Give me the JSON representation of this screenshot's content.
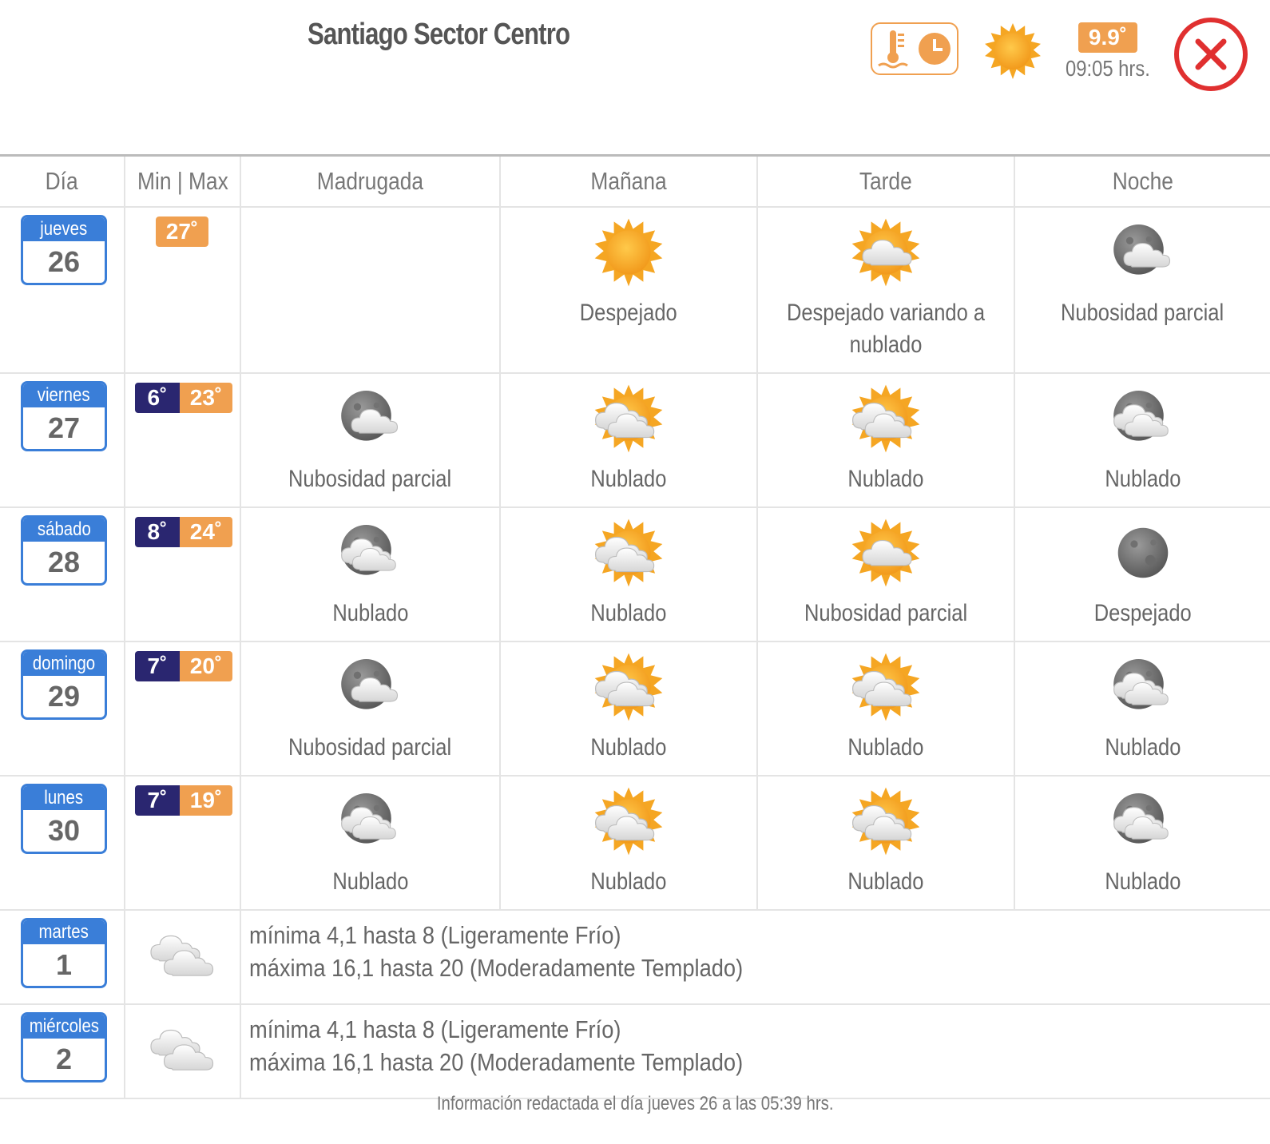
{
  "header": {
    "title": "Santiago Sector Centro",
    "current_temp": "9.9˚",
    "current_time": "09:05 hrs."
  },
  "columns": [
    "Día",
    "Min | Max",
    "Madrugada",
    "Mañana",
    "Tarde",
    "Noche"
  ],
  "days": [
    {
      "name": "jueves",
      "date": "26",
      "min": "",
      "max": "27˚",
      "madrugada": {
        "icon": "",
        "label": ""
      },
      "manana": {
        "icon": "sun",
        "label": "Despejado"
      },
      "tarde": {
        "icon": "sun-cloud",
        "label": "Despejado variando a nublado"
      },
      "noche": {
        "icon": "moon-cloud",
        "label": "Nubosidad parcial"
      }
    },
    {
      "name": "viernes",
      "date": "27",
      "min": "6˚",
      "max": "23˚",
      "madrugada": {
        "icon": "moon-cloud",
        "label": "Nubosidad parcial"
      },
      "manana": {
        "icon": "sun-clouds",
        "label": "Nublado"
      },
      "tarde": {
        "icon": "sun-clouds",
        "label": "Nublado"
      },
      "noche": {
        "icon": "moon-clouds",
        "label": "Nublado"
      }
    },
    {
      "name": "sábado",
      "date": "28",
      "min": "8˚",
      "max": "24˚",
      "madrugada": {
        "icon": "moon-clouds",
        "label": "Nublado"
      },
      "manana": {
        "icon": "sun-clouds",
        "label": "Nublado"
      },
      "tarde": {
        "icon": "sun-cloud",
        "label": "Nubosidad parcial"
      },
      "noche": {
        "icon": "moon",
        "label": "Despejado"
      }
    },
    {
      "name": "domingo",
      "date": "29",
      "min": "7˚",
      "max": "20˚",
      "madrugada": {
        "icon": "moon-cloud",
        "label": "Nubosidad parcial"
      },
      "manana": {
        "icon": "sun-clouds",
        "label": "Nublado"
      },
      "tarde": {
        "icon": "sun-clouds",
        "label": "Nublado"
      },
      "noche": {
        "icon": "moon-clouds",
        "label": "Nublado"
      }
    },
    {
      "name": "lunes",
      "date": "30",
      "min": "7˚",
      "max": "19˚",
      "madrugada": {
        "icon": "moon-clouds",
        "label": "Nublado"
      },
      "manana": {
        "icon": "sun-clouds",
        "label": "Nublado"
      },
      "tarde": {
        "icon": "sun-clouds",
        "label": "Nublado"
      },
      "noche": {
        "icon": "moon-clouds",
        "label": "Nublado"
      }
    }
  ],
  "extended": [
    {
      "name": "martes",
      "date": "1",
      "line1": "mínima 4,1 hasta 8 (Ligeramente Frío)",
      "line2": "máxima 16,1 hasta 20 (Moderadamente Templado)"
    },
    {
      "name": "miércoles",
      "date": "2",
      "line1": "mínima 4,1 hasta 8 (Ligeramente Frío)",
      "line2": "máxima 16,1 hasta 20 (Moderadamente Templado)"
    }
  ],
  "footer": "Información redactada el día jueves 26 a las 05:39 hrs.",
  "colors": {
    "accent_blue": "#3a7ed8",
    "min_navy": "#2a2670",
    "max_orange": "#f0a050",
    "close_red": "#e03030"
  }
}
